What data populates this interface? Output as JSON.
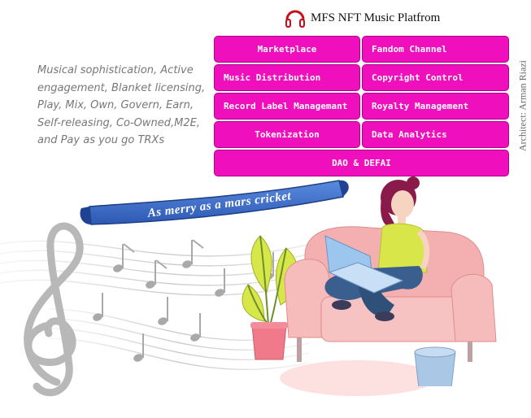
{
  "header": {
    "title": "MFS NFT Music  Platfrom",
    "logo_icon": "headphones-icon"
  },
  "menu": {
    "marketplace": "Marketplace",
    "fandom_channel": "Fandom Channel",
    "music_distribution": "Music Distribution",
    "copyright_control": "Copyright Control",
    "record_label_management": "Record Label Managemant",
    "royalty_management": "Royalty Management",
    "tokenization": "Tokenization",
    "data_analytics": "Data Analytics",
    "dao_defai": "DAO & DEFAI"
  },
  "tagline": {
    "line1": "Musical sophistication, Active",
    "line2": "engagement, Blanket licensing,",
    "line3": "Play, Mix, Own, Govern, Earn,",
    "line4": "Self-releasing, Co-Owned,M2E,",
    "line5": "and Pay as you go TRXs"
  },
  "ribbon_text": "As merry as a mars cricket",
  "architect": "Architect: Arman Riazi",
  "colors": {
    "button": "#f00fbd",
    "ribbon": "#3d6fd1",
    "sofa": "#f2a7a7",
    "shirt": "#d9e64a",
    "jeans": "#3a5f8f"
  }
}
